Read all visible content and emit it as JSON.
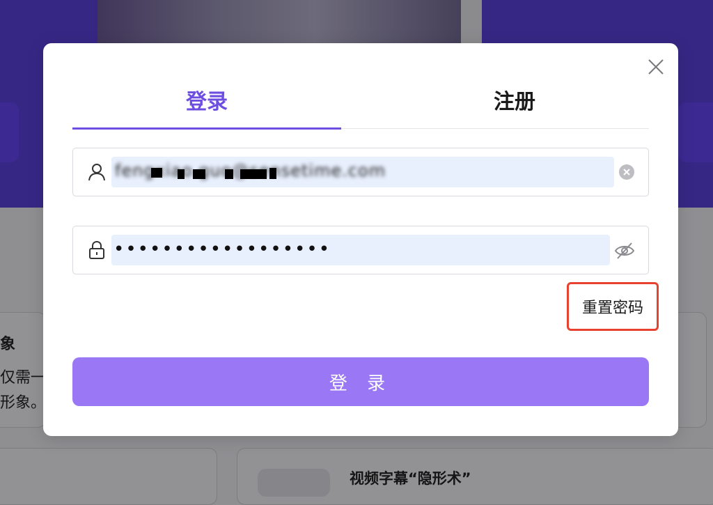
{
  "tabs": {
    "login": "登录",
    "register": "注册"
  },
  "username": {
    "value": "fengxiao.guo@sensetime.com"
  },
  "password": {
    "masked": "••••••••••••••••••"
  },
  "reset_password_label": "重置密码",
  "submit_label": "登 录",
  "background": {
    "card_left_line1": "象",
    "card_left_line2": "仅需一",
    "card_left_line3": "形象。",
    "card_title": "视频字幕“隐形术”"
  },
  "colors": {
    "accent": "#6d4ee0",
    "submit_bg": "#9a78f5",
    "highlight_border": "#e8412f",
    "autofill_bg": "#e8effd"
  },
  "icons": {
    "close": "close-icon",
    "user": "user-icon",
    "lock": "lock-icon",
    "clear": "clear-icon",
    "eye": "eye-off-icon"
  }
}
